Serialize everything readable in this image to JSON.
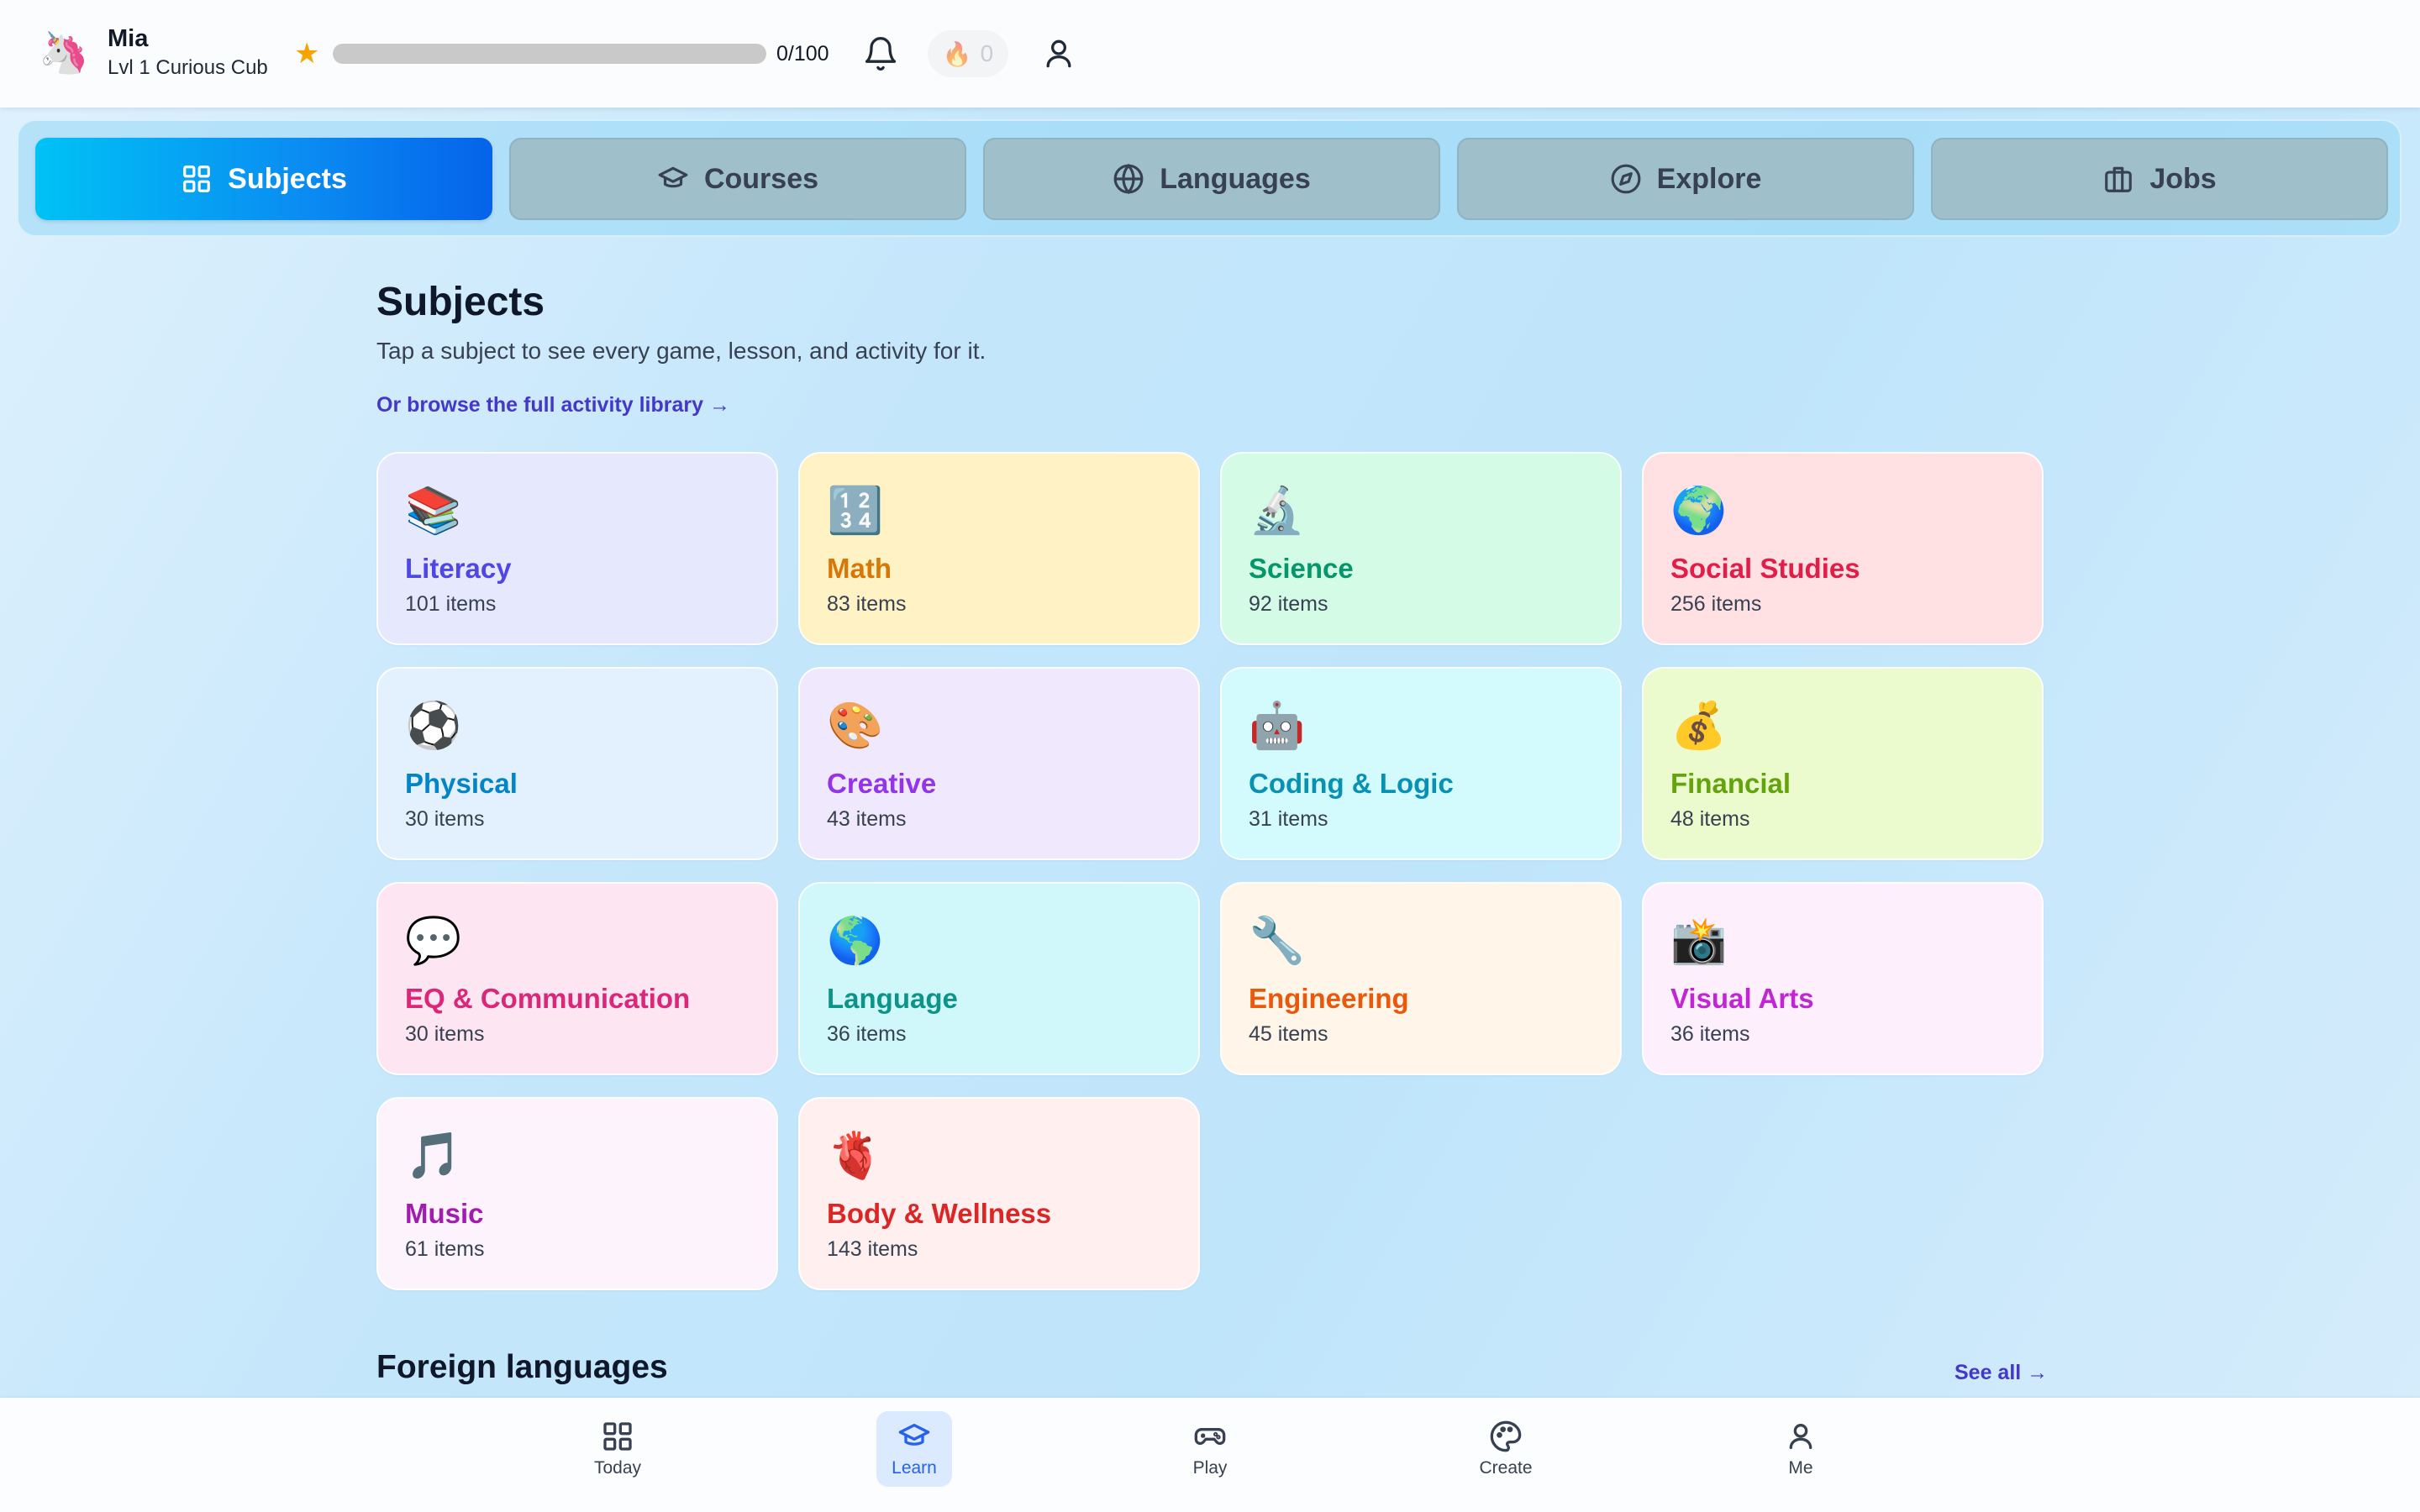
{
  "user": {
    "avatar_emoji": "🦄",
    "name": "Mia",
    "level": "Lvl 1 Curious Cub",
    "xp_text": "0/100",
    "xp_progress": 0,
    "streak_count": "0",
    "streak_icon": "flame-icon"
  },
  "tabs": [
    {
      "label": "Subjects",
      "icon": "grid-icon",
      "active": true
    },
    {
      "label": "Courses",
      "icon": "graduation-cap-icon",
      "active": false
    },
    {
      "label": "Languages",
      "icon": "globe-icon",
      "active": false
    },
    {
      "label": "Explore",
      "icon": "compass-icon",
      "active": false
    },
    {
      "label": "Jobs",
      "icon": "briefcase-icon",
      "active": false
    }
  ],
  "main": {
    "title": "Subjects",
    "subtitle": "Tap a subject to see every game, lesson, and activity for it.",
    "browse_link": "Or browse the full activity library →"
  },
  "subjects": [
    {
      "name": "Literacy",
      "count": "101 items",
      "emoji": "📚",
      "bg": "#e6e8fd",
      "color": "#4f46e5"
    },
    {
      "name": "Math",
      "count": "83 items",
      "emoji": "🔢",
      "bg": "#fff2c5",
      "color": "#d97706"
    },
    {
      "name": "Science",
      "count": "92 items",
      "emoji": "🔬",
      "bg": "#d4fbe6",
      "color": "#059669"
    },
    {
      "name": "Social Studies",
      "count": "256 items",
      "emoji": "🌍",
      "bg": "#ffe1e4",
      "color": "#e11d48"
    },
    {
      "name": "Physical",
      "count": "30 items",
      "emoji": "⚽",
      "bg": "#e3f1fe",
      "color": "#0284c7"
    },
    {
      "name": "Creative",
      "count": "43 items",
      "emoji": "🎨",
      "bg": "#f0e8fd",
      "color": "#9333ea"
    },
    {
      "name": "Coding & Logic",
      "count": "31 items",
      "emoji": "🤖",
      "bg": "#d3fafd",
      "color": "#0891b2"
    },
    {
      "name": "Financial",
      "count": "48 items",
      "emoji": "💰",
      "bg": "#ebfbcd",
      "color": "#65a30d"
    },
    {
      "name": "EQ & Communication",
      "count": "30 items",
      "emoji": "💬",
      "bg": "#fde5f1",
      "color": "#db2777"
    },
    {
      "name": "Language",
      "count": "36 items",
      "emoji": "🌎",
      "bg": "#d0f8fb",
      "color": "#0d9488"
    },
    {
      "name": "Engineering",
      "count": "45 items",
      "emoji": "🔧",
      "bg": "#fff5e8",
      "color": "#ea580c"
    },
    {
      "name": "Visual Arts",
      "count": "36 items",
      "emoji": "📸",
      "bg": "#fdf0fc",
      "color": "#c026d3"
    },
    {
      "name": "Music",
      "count": "61 items",
      "emoji": "🎵",
      "bg": "#fcf3fc",
      "color": "#a21caf"
    },
    {
      "name": "Body & Wellness",
      "count": "143 items",
      "emoji": "🫀",
      "bg": "#fff0ef",
      "color": "#dc2626"
    }
  ],
  "foreign": {
    "title": "Foreign languages",
    "see_all": "See all →"
  },
  "bottom_nav": [
    {
      "label": "Today",
      "icon": "grid-icon",
      "active": false
    },
    {
      "label": "Learn",
      "icon": "graduation-cap-icon",
      "active": true
    },
    {
      "label": "Play",
      "icon": "gamepad-icon",
      "active": false
    },
    {
      "label": "Create",
      "icon": "palette-icon",
      "active": false
    },
    {
      "label": "Me",
      "icon": "user-icon",
      "active": false
    }
  ],
  "colors": {
    "accent": "#0a8bf2",
    "link": "#4338ca",
    "star": "#f5a400"
  }
}
